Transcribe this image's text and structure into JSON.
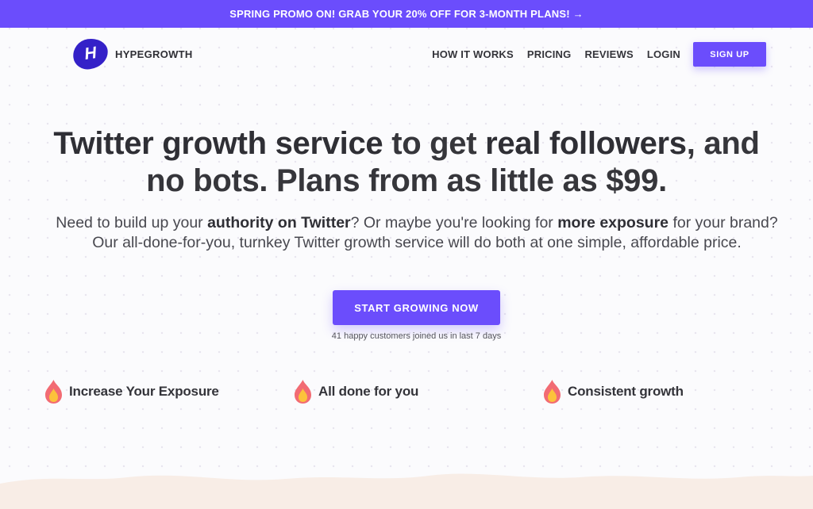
{
  "promo": {
    "text": "SPRING PROMO ON! GRAB YOUR 20% OFF FOR 3-MONTH PLANS! →"
  },
  "header": {
    "logo_letter": "H",
    "brand": "HYPEGROWTH",
    "nav": [
      "HOW IT WORKS",
      "PRICING",
      "REVIEWS",
      "LOGIN"
    ],
    "signup_label": "SIGN UP"
  },
  "hero": {
    "title": {
      "part1": "Twitter growth service",
      "part2": " to get ",
      "part3": "real followers",
      "part4": ", and no bots. Plans from as little as $99."
    },
    "description": {
      "part1": "Need to build up your ",
      "part2": "authority on Twitter",
      "part3": "? Or maybe you're looking for ",
      "part4": "more exposure",
      "part5": " for your brand? Our all-done-for-you, turnkey Twitter growth service will do both at one simple, affordable price."
    },
    "cta_label": "START GROWING NOW",
    "cta_note": "41 happy customers joined us in last 7 days"
  },
  "features": [
    {
      "icon": "flame-icon",
      "label": "Increase Your Exposure"
    },
    {
      "icon": "flame-icon",
      "label": "All done for you"
    },
    {
      "icon": "flame-icon",
      "label": "Consistent growth"
    }
  ],
  "colors": {
    "accent": "#6b4dfc",
    "logo": "#3421c8",
    "flame_outer": "#f26b73",
    "flame_inner": "#fcc23b",
    "wave": "#f8ede6"
  }
}
